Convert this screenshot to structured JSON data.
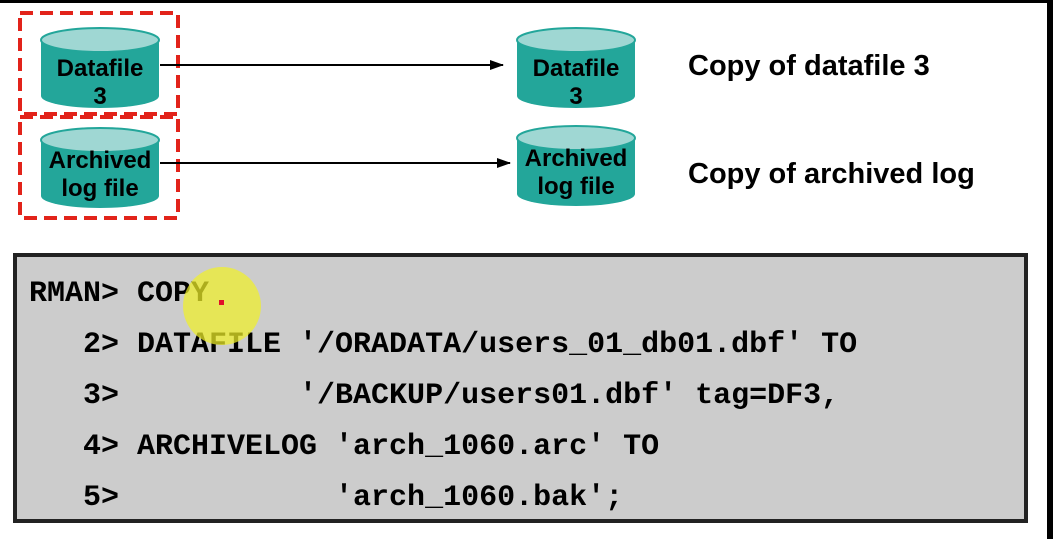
{
  "diagram": {
    "source": {
      "datafile": {
        "line1": "Datafile",
        "line2": "3"
      },
      "archived_log": {
        "line1": "Archived",
        "line2": "log file"
      }
    },
    "target": {
      "datafile": {
        "line1": "Datafile",
        "line2": "3"
      },
      "archived_log": {
        "line1": "Archived",
        "line2": "log file"
      }
    },
    "captions": {
      "datafile_copy": "Copy of datafile 3",
      "archived_log_copy": "Copy of archived log"
    }
  },
  "code": {
    "lines": [
      "RMAN> COPY",
      "   2> DATAFILE '/ORADATA/users_01_db01.dbf' TO",
      "   3>          '/BACKUP/users01.dbf' tag=DF3,",
      "   4> ARCHIVELOG 'arch_1060.arc' TO",
      "   5>            'arch_1060.bak';"
    ]
  },
  "colors": {
    "cylinder_top": "#9fd7d3",
    "cylinder_body": "#23a69a",
    "selection_dash": "#e2231a",
    "code_background": "#cccccc",
    "cursor_highlight": "#f0f028"
  }
}
